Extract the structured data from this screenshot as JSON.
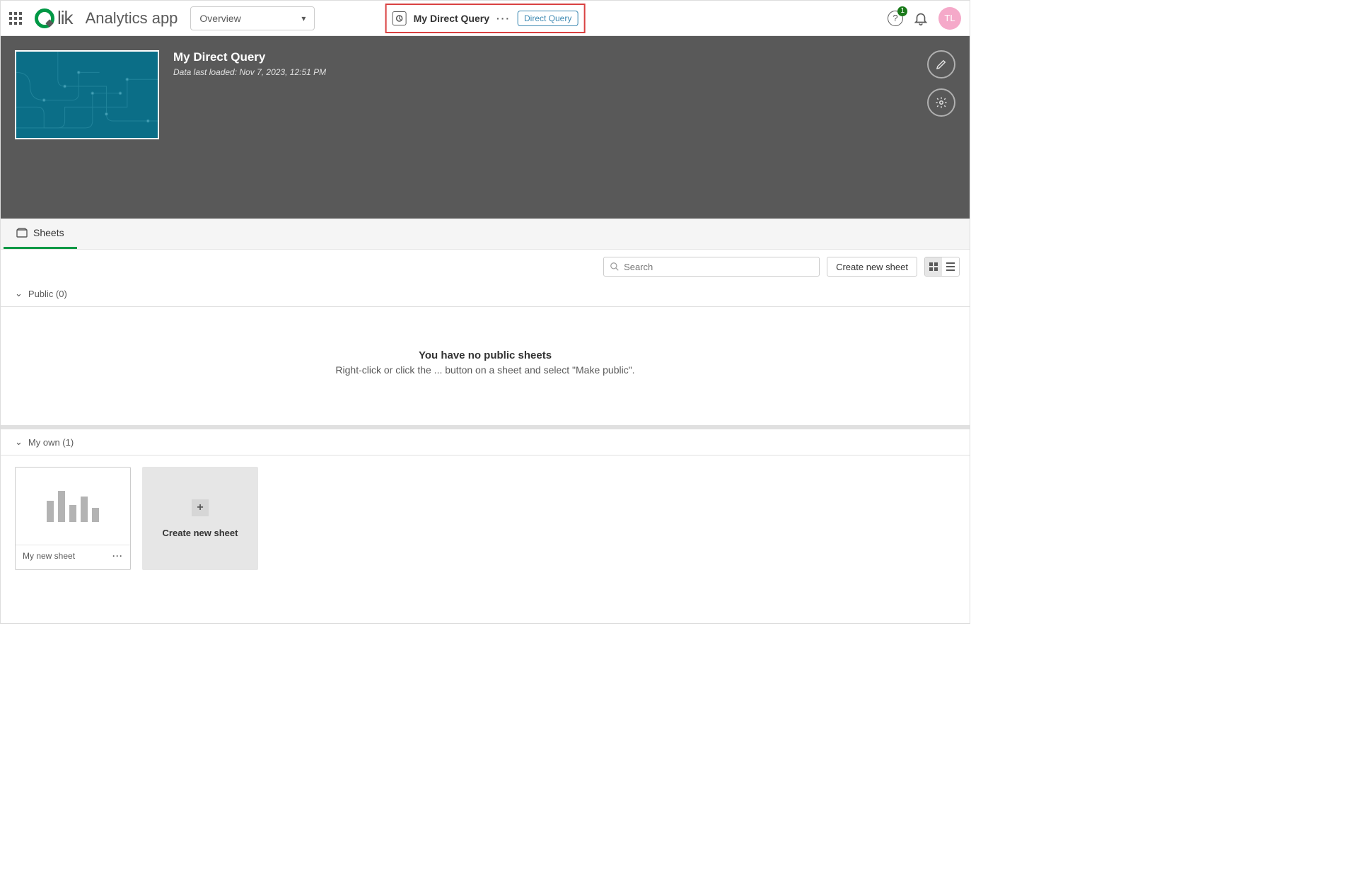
{
  "topnav": {
    "app_title": "Analytics app",
    "dropdown_value": "Overview",
    "center_app_name": "My Direct Query",
    "badge_text": "Direct Query",
    "notif_count": "1",
    "avatar_initials": "TL",
    "logo_text": "lik"
  },
  "hero": {
    "title": "My Direct Query",
    "subtitle": "Data last loaded: Nov 7, 2023, 12:51 PM"
  },
  "tabs": {
    "sheets": "Sheets"
  },
  "toolbar": {
    "search_placeholder": "Search",
    "create_btn": "Create new sheet"
  },
  "sections": {
    "public_label": "Public (0)",
    "empty_title": "You have no public sheets",
    "empty_body": "Right-click or click the ... button on a sheet and select \"Make public\".",
    "myown_label": "My own (1)"
  },
  "sheets": {
    "card1_name": "My new sheet",
    "new_card_label": "Create new sheet"
  }
}
